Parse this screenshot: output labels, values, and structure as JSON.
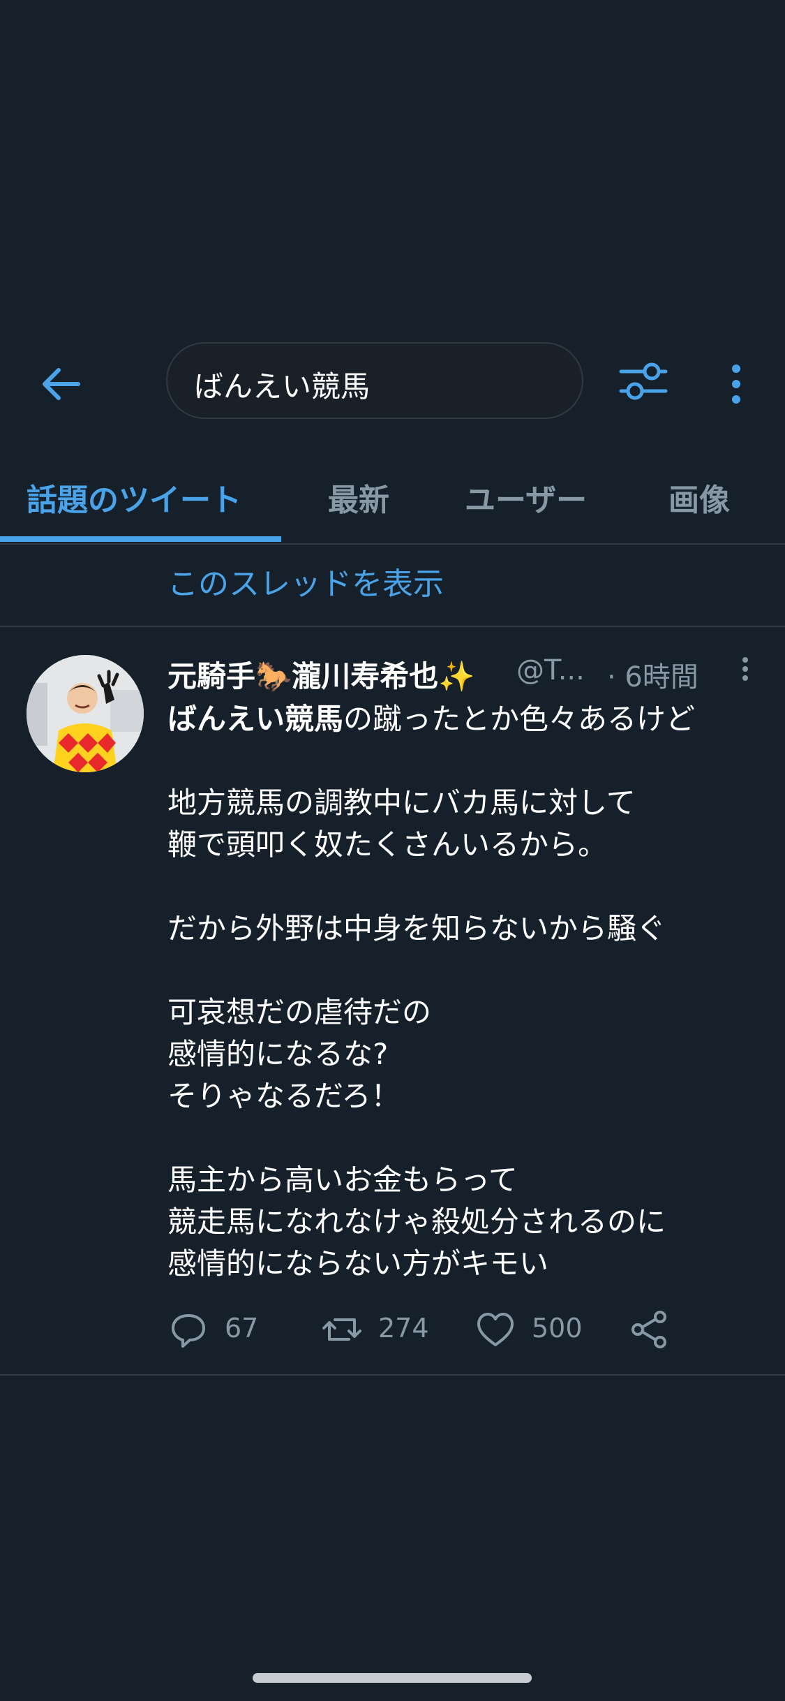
{
  "search": {
    "query": "ばんえい競馬"
  },
  "tabs": [
    {
      "label": "話題のツイート",
      "active": true
    },
    {
      "label": "最新",
      "active": false
    },
    {
      "label": "ユーザー",
      "active": false
    },
    {
      "label": "画像",
      "active": false
    }
  ],
  "thread_link": "このスレッドを表示",
  "tweet": {
    "author_name": "元騎手🐎瀧川寿希也✨",
    "handle": "@T...",
    "time": "· 6時間",
    "first_line_keyword": "ばんえい競馬",
    "first_line_rest": "の蹴ったとか色々あるけど",
    "lines": [
      "",
      "地方競馬の調教中にバカ馬に対して",
      "鞭で頭叩く奴たくさんいるから。",
      "",
      "だから外野は中身を知らないから騒ぐ",
      "",
      "可哀想だの虐待だの",
      "感情的になるな?",
      "そりゃなるだろ！",
      "",
      "馬主から高いお金もらって",
      "競走馬になれなけゃ殺処分されるのに",
      "感情的にならない方がキモい"
    ],
    "replies": "67",
    "retweets": "274",
    "likes": "500"
  },
  "colors": {
    "background": "#15202b",
    "accent": "#4aa3e8",
    "secondary_text": "#8899a6",
    "divider": "#2f3a45"
  }
}
